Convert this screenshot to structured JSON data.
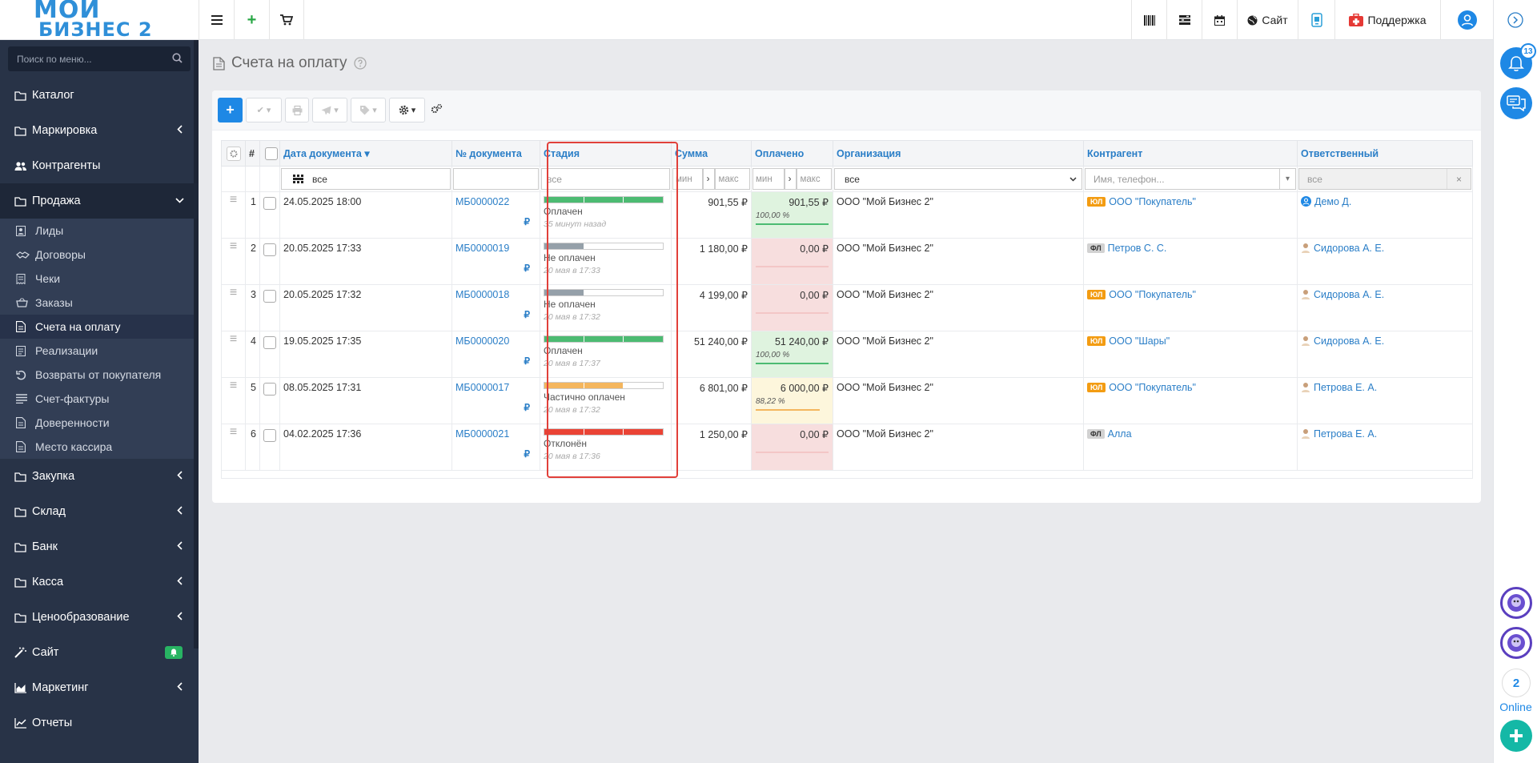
{
  "brand": {
    "logo_line1": "МОЙ",
    "logo_line2": "БИЗНЕС 2"
  },
  "topbar": {
    "site_label": "Сайт",
    "support_label": "Поддержка"
  },
  "sidebar": {
    "search_placeholder": "Поиск по меню...",
    "items": [
      {
        "label": "Каталог",
        "icon": "folder-icon"
      },
      {
        "label": "Маркировка",
        "icon": "folder-icon"
      },
      {
        "label": "Контрагенты",
        "icon": "users-icon"
      },
      {
        "label": "Продажа",
        "icon": "folder-icon"
      },
      {
        "label": "Закупка",
        "icon": "folder-icon"
      },
      {
        "label": "Склад",
        "icon": "folder-icon"
      },
      {
        "label": "Банк",
        "icon": "folder-icon"
      },
      {
        "label": "Касса",
        "icon": "folder-icon"
      },
      {
        "label": "Ценообразование",
        "icon": "folder-icon"
      },
      {
        "label": "Сайт",
        "icon": "magic-wand-icon"
      },
      {
        "label": "Маркетинг",
        "icon": "chart-area-icon"
      },
      {
        "label": "Отчеты",
        "icon": "line-chart-icon"
      }
    ],
    "sales_sub": [
      "Лиды",
      "Договоры",
      "Чеки",
      "Заказы",
      "Счета на оплату",
      "Реализации",
      "Возвраты от покупателя",
      "Счет-фактуры",
      "Доверенности",
      "Место кассира"
    ]
  },
  "page": {
    "title": "Счета на оплату"
  },
  "table": {
    "headers": {
      "num": "#",
      "date": "Дата документа",
      "docnum": "№ документа",
      "stage": "Стадия",
      "sum": "Сумма",
      "paid": "Оплачено",
      "org": "Организация",
      "contractor": "Контрагент",
      "responsible": "Ответственный"
    },
    "filters": {
      "date": "все",
      "stage": "все",
      "min": "мин",
      "max": "макс",
      "org": "все",
      "contractor": "Имя, телефон...",
      "responsible": "все",
      "clear": "×"
    },
    "rows": [
      {
        "n": "1",
        "date": "24.05.2025 18:00",
        "doc": "МБ0000022",
        "stage": "Оплачен",
        "stage_date": "35 минут назад",
        "stage_level": 1.0,
        "sum": "901,55 ₽",
        "paid": "901,55 ₽",
        "pct": "100,00 %",
        "org": "ООО \"Мой Бизнес 2\"",
        "ctype": "ЮЛ",
        "contractor": "ООО \"Покупатель\"",
        "resp": "Демо Д."
      },
      {
        "n": "2",
        "date": "20.05.2025 17:33",
        "doc": "МБ0000019",
        "stage": "Не оплачен",
        "stage_date": "20 мая в 17:33",
        "stage_level": 0.33,
        "sum": "1 180,00 ₽",
        "paid": "0,00 ₽",
        "pct": "",
        "org": "ООО \"Мой Бизнес 2\"",
        "ctype": "ФЛ",
        "contractor": "Петров С. С.",
        "resp": "Сидорова А. Е."
      },
      {
        "n": "3",
        "date": "20.05.2025 17:32",
        "doc": "МБ0000018",
        "stage": "Не оплачен",
        "stage_date": "20 мая в 17:32",
        "stage_level": 0.33,
        "sum": "4 199,00 ₽",
        "paid": "0,00 ₽",
        "pct": "",
        "org": "ООО \"Мой Бизнес 2\"",
        "ctype": "ЮЛ",
        "contractor": "ООО \"Покупатель\"",
        "resp": "Сидорова А. Е."
      },
      {
        "n": "4",
        "date": "19.05.2025 17:35",
        "doc": "МБ0000020",
        "stage": "Оплачен",
        "stage_date": "20 мая в 17:37",
        "stage_level": 1.0,
        "sum": "51 240,00 ₽",
        "paid": "51 240,00 ₽",
        "pct": "100,00 %",
        "org": "ООО \"Мой Бизнес 2\"",
        "ctype": "ЮЛ",
        "contractor": "ООО \"Шары\"",
        "resp": "Сидорова А. Е."
      },
      {
        "n": "5",
        "date": "08.05.2025 17:31",
        "doc": "МБ0000017",
        "stage": "Частично оплачен",
        "stage_date": "20 мая в 17:32",
        "stage_level": 0.67,
        "sum": "6 801,00 ₽",
        "paid": "6 000,00 ₽",
        "pct": "88,22 %",
        "org": "ООО \"Мой Бизнес 2\"",
        "ctype": "ЮЛ",
        "contractor": "ООО \"Покупатель\"",
        "resp": "Петрова Е. А."
      },
      {
        "n": "6",
        "date": "04.02.2025 17:36",
        "doc": "МБ0000021",
        "stage": "Отклонён",
        "stage_date": "20 мая в 17:36",
        "stage_level": 1.0,
        "sum": "1 250,00 ₽",
        "paid": "0,00 ₽",
        "pct": "",
        "org": "ООО \"Мой Бизнес 2\"",
        "ctype": "ФЛ",
        "contractor": "Алла",
        "resp": "Петрова Е. А."
      }
    ]
  },
  "right_panel": {
    "notif_count": "13",
    "online_count": "2",
    "online_label": "Online"
  },
  "colors": {
    "paid": "#4cbb72",
    "unpaid": "#95a0a9",
    "partial": "#f4b65e",
    "rejected": "#ea4335",
    "accent": "#2a7ec7",
    "sidebar": "#283347"
  }
}
